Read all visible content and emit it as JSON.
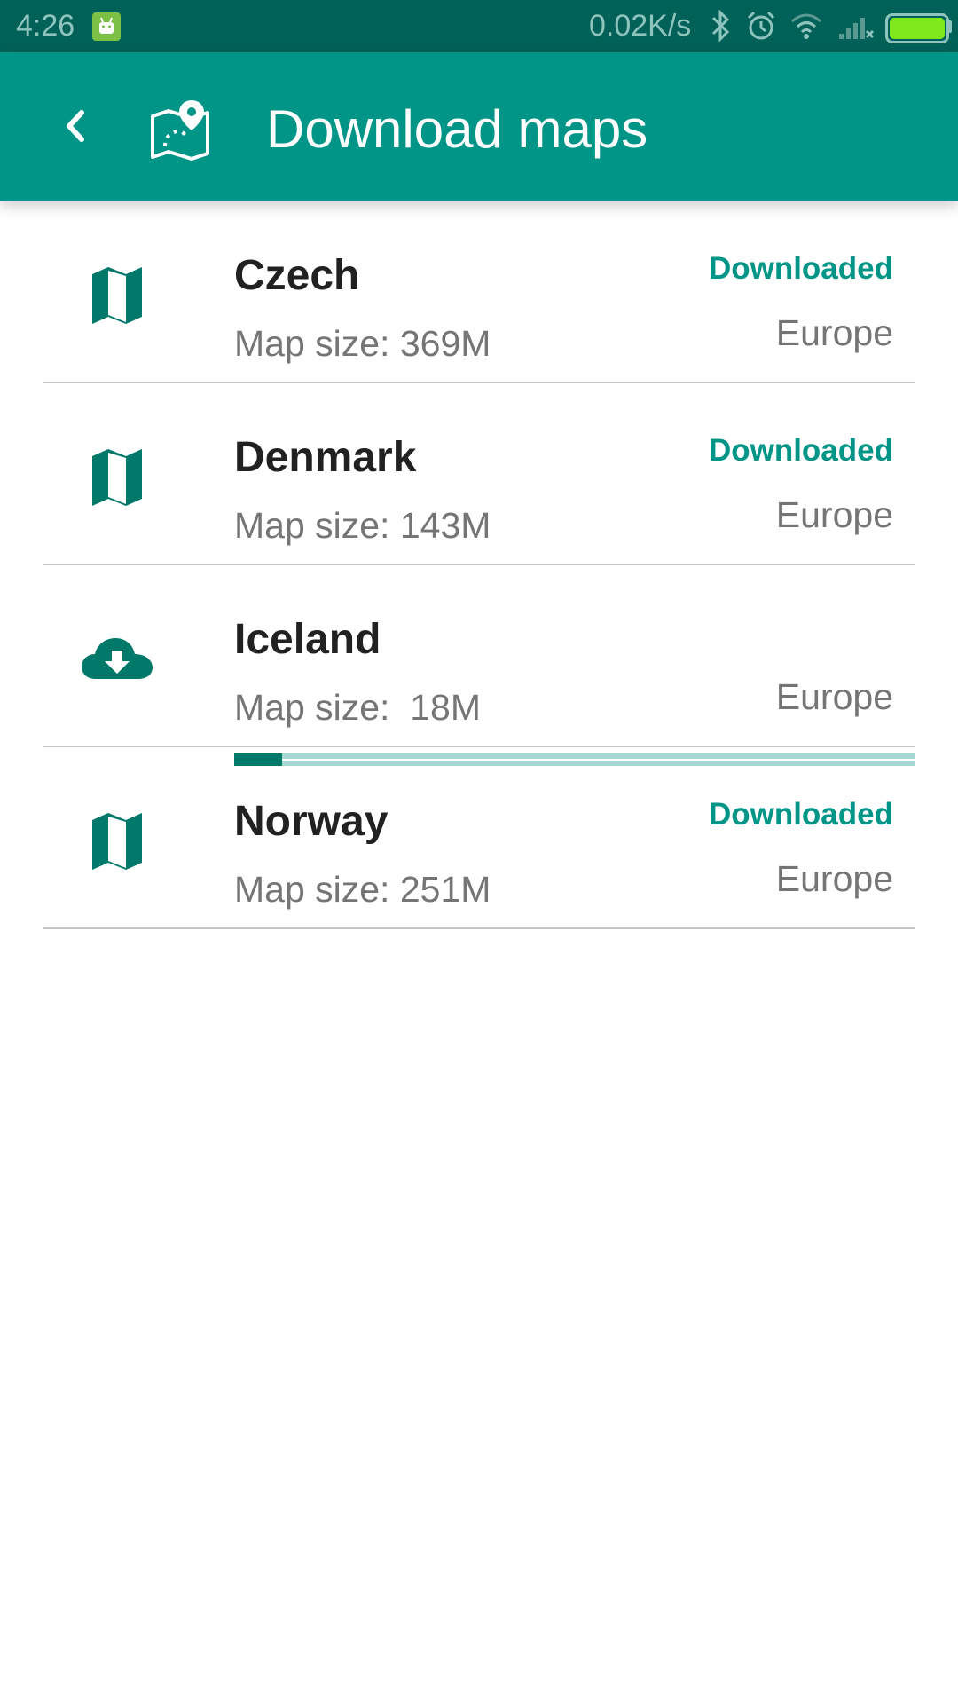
{
  "status_bar": {
    "time": "4:26",
    "network_speed": "0.02K/s",
    "icons": [
      "android-notification-icon",
      "bluetooth-icon",
      "alarm-icon",
      "wifi-icon",
      "cell-signal-icon",
      "battery-icon"
    ]
  },
  "app_bar": {
    "title": "Download maps",
    "back_icon": "chevron-left-icon",
    "logo_icon": "map-pin-icon"
  },
  "colors": {
    "accent": "#009586",
    "status_bar": "#006158",
    "downloaded_text": "#009586",
    "progress_fill": "#00796b",
    "battery": "#7ee81d"
  },
  "maps": [
    {
      "name": "Czech",
      "size": "Map size: 369M",
      "status": "Downloaded",
      "region": "Europe",
      "icon": "map-icon"
    },
    {
      "name": "Denmark",
      "size": "Map size: 143M",
      "status": "Downloaded",
      "region": "Europe",
      "icon": "map-icon"
    },
    {
      "name": "Iceland",
      "size": "Map size:  18M",
      "status": "",
      "region": "Europe",
      "icon": "cloud-download-icon",
      "download_progress": 0.07
    },
    {
      "name": "Norway",
      "size": "Map size: 251M",
      "status": "Downloaded",
      "region": "Europe",
      "icon": "map-icon"
    }
  ]
}
